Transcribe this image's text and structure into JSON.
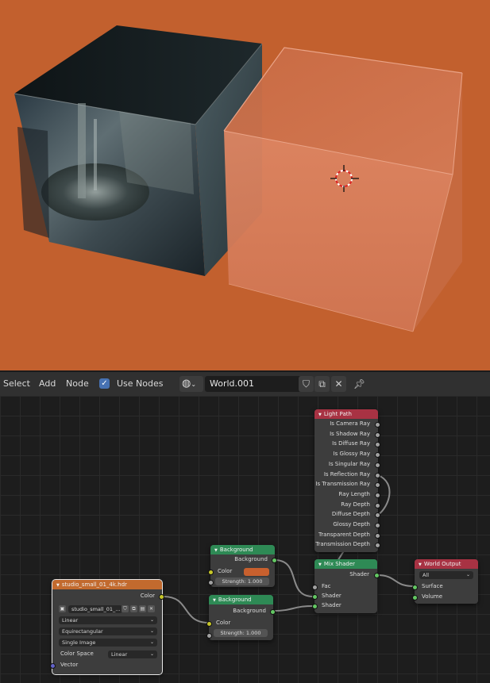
{
  "header": {
    "menus": [
      "Select",
      "Add",
      "Node"
    ],
    "use_nodes_label": "Use Nodes",
    "world_name": "World.001"
  },
  "colors": {
    "viewport_bg": "#c2602e",
    "texture_node_header": "#c26a2e",
    "shader_node_header": "#2e8a55",
    "input_node_header": "#a83243",
    "output_node_header": "#a83243",
    "background_color_swatch": "#c8602e"
  },
  "nodes": {
    "environment_texture": {
      "title": "studio_small_01_4k.hdr",
      "out_color": "Color",
      "image_name": "studio_small_01_...",
      "interpolation": "Linear",
      "projection": "Equirectangular",
      "source": "Single Image",
      "color_space_label": "Color Space",
      "color_space_value": "Linear",
      "in_vector": "Vector"
    },
    "background_1": {
      "title": "Background",
      "out_label": "Background",
      "color_label": "Color",
      "strength": "Strength:  1.000"
    },
    "background_2": {
      "title": "Background",
      "out_label": "Background",
      "color_label": "Color",
      "strength": "Strength:  1.000"
    },
    "light_path": {
      "title": "Light Path",
      "outputs": [
        "Is Camera Ray",
        "Is Shadow Ray",
        "Is Diffuse Ray",
        "Is Glossy Ray",
        "Is Singular Ray",
        "Is Reflection Ray",
        "Is Transmission Ray",
        "Ray Length",
        "Ray Depth",
        "Diffuse Depth",
        "Glossy Depth",
        "Transparent Depth",
        "Transmission Depth"
      ]
    },
    "mix_shader": {
      "title": "Mix Shader",
      "out_label": "Shader",
      "in_fac": "Fac",
      "in_shader_1": "Shader",
      "in_shader_2": "Shader"
    },
    "world_output": {
      "title": "World Output",
      "target": "All",
      "in_surface": "Surface",
      "in_volume": "Volume"
    }
  },
  "icons": [
    "world-icon",
    "chevron-down-icon",
    "shield-icon",
    "duplicate-icon",
    "close-icon",
    "pin-icon",
    "image-icon",
    "3d-cursor-icon"
  ]
}
